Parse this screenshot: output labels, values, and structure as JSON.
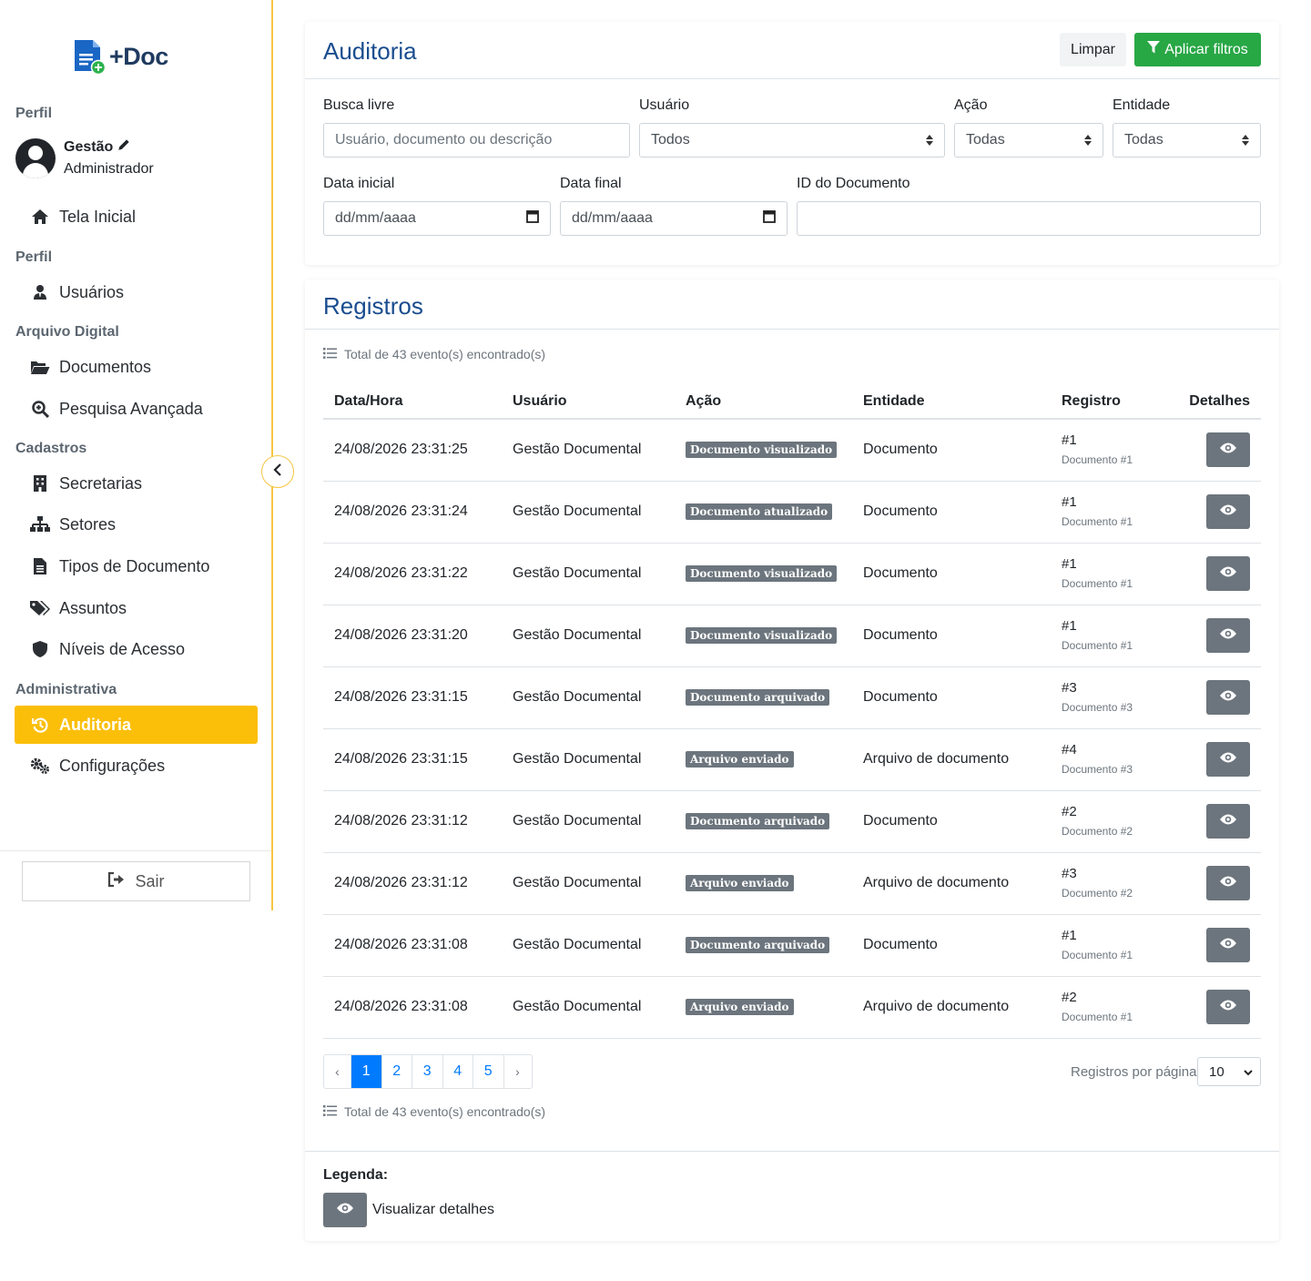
{
  "sidebar": {
    "logo_text": "+Doc",
    "profile_section": "Perfil",
    "profile_name": "Gestão",
    "profile_role": "Administrador",
    "home": "Tela Inicial",
    "section_perfil": "Perfil",
    "users": "Usuários",
    "section_arquivo": "Arquivo Digital",
    "documents": "Documentos",
    "advanced_search": "Pesquisa Avançada",
    "section_cadastros": "Cadastros",
    "secretarias": "Secretarias",
    "setores": "Setores",
    "tipos_documento": "Tipos de Documento",
    "assuntos": "Assuntos",
    "niveis_acesso": "Níveis de Acesso",
    "section_admin": "Administrativa",
    "auditoria": "Auditoria",
    "configuracoes": "Configurações",
    "logout": "Sair",
    "accent_color": "#fbbf0a"
  },
  "filters": {
    "title": "Auditoria",
    "clear_label": "Limpar",
    "apply_label": "Aplicar filtros",
    "busca_label": "Busca livre",
    "busca_placeholder": "Usuário, documento ou descrição",
    "usuario_label": "Usuário",
    "usuario_value": "Todos",
    "acao_label": "Ação",
    "acao_value": "Todas",
    "entidade_label": "Entidade",
    "entidade_value": "Todas",
    "data_inicial_label": "Data inicial",
    "data_inicial_placeholder": "dd/mm/aaaa",
    "data_final_label": "Data final",
    "data_final_placeholder": "dd/mm/aaaa",
    "id_doc_label": "ID do Documento",
    "id_doc_value": ""
  },
  "records": {
    "title": "Registros",
    "total_text": "Total de 43 evento(s) encontrado(s)",
    "columns": [
      "Data/Hora",
      "Usuário",
      "Ação",
      "Entidade",
      "Registro",
      "Detalhes"
    ],
    "rows": [
      {
        "datetime": "24/08/2026 23:31:25",
        "user": "Gestão Documental",
        "action": "Documento visualizado",
        "entity": "Documento",
        "reg_num": "#1",
        "reg_doc": "Documento #1"
      },
      {
        "datetime": "24/08/2026 23:31:24",
        "user": "Gestão Documental",
        "action": "Documento atualizado",
        "entity": "Documento",
        "reg_num": "#1",
        "reg_doc": "Documento #1"
      },
      {
        "datetime": "24/08/2026 23:31:22",
        "user": "Gestão Documental",
        "action": "Documento visualizado",
        "entity": "Documento",
        "reg_num": "#1",
        "reg_doc": "Documento #1"
      },
      {
        "datetime": "24/08/2026 23:31:20",
        "user": "Gestão Documental",
        "action": "Documento visualizado",
        "entity": "Documento",
        "reg_num": "#1",
        "reg_doc": "Documento #1"
      },
      {
        "datetime": "24/08/2026 23:31:15",
        "user": "Gestão Documental",
        "action": "Documento arquivado",
        "entity": "Documento",
        "reg_num": "#3",
        "reg_doc": "Documento #3"
      },
      {
        "datetime": "24/08/2026 23:31:15",
        "user": "Gestão Documental",
        "action": "Arquivo enviado",
        "entity": "Arquivo de documento",
        "reg_num": "#4",
        "reg_doc": "Documento #3"
      },
      {
        "datetime": "24/08/2026 23:31:12",
        "user": "Gestão Documental",
        "action": "Documento arquivado",
        "entity": "Documento",
        "reg_num": "#2",
        "reg_doc": "Documento #2"
      },
      {
        "datetime": "24/08/2026 23:31:12",
        "user": "Gestão Documental",
        "action": "Arquivo enviado",
        "entity": "Arquivo de documento",
        "reg_num": "#3",
        "reg_doc": "Documento #2"
      },
      {
        "datetime": "24/08/2026 23:31:08",
        "user": "Gestão Documental",
        "action": "Documento arquivado",
        "entity": "Documento",
        "reg_num": "#1",
        "reg_doc": "Documento #1"
      },
      {
        "datetime": "24/08/2026 23:31:08",
        "user": "Gestão Documental",
        "action": "Arquivo enviado",
        "entity": "Arquivo de documento",
        "reg_num": "#2",
        "reg_doc": "Documento #1"
      }
    ],
    "pagination": {
      "prev": "‹",
      "pages": [
        "1",
        "2",
        "3",
        "4",
        "5"
      ],
      "current": "1",
      "next": "›"
    },
    "per_page_label": "Registros por página",
    "per_page_value": "10",
    "legend_title": "Legenda:",
    "legend_item": "Visualizar detalhes"
  }
}
